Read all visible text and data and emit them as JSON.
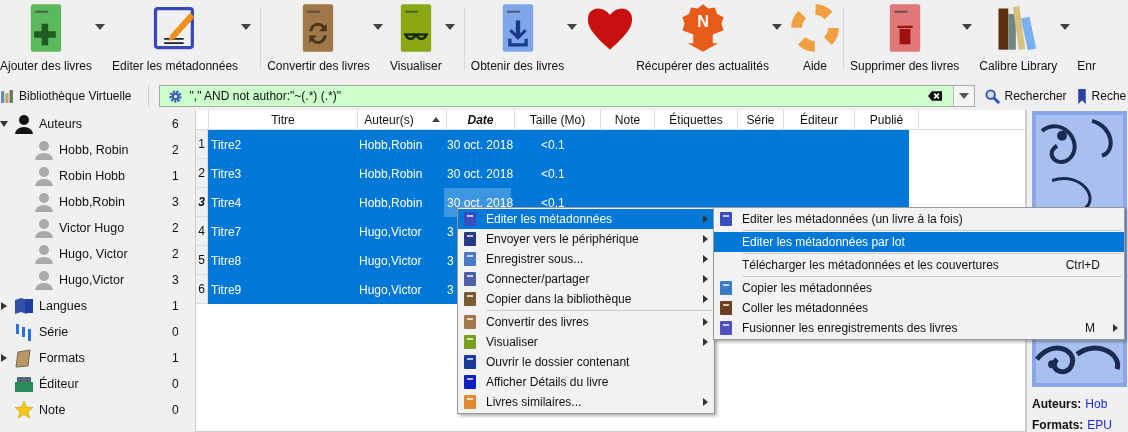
{
  "toolbar": {
    "groups": [
      [
        {
          "kind": "add",
          "label": "Ajouter des livres",
          "has_menu": true
        },
        {
          "kind": "edit",
          "label": "Editer les métadonnées",
          "has_menu": true
        }
      ],
      [
        {
          "kind": "convert",
          "label": "Convertir des livres",
          "has_menu": true
        },
        {
          "kind": "view",
          "label": "Visualiser",
          "has_menu": true
        }
      ],
      [
        {
          "kind": "get",
          "label": "Obtenir des livres",
          "has_menu": true
        },
        {
          "kind": "donate",
          "has_menu": false
        },
        {
          "kind": "news",
          "label": "Récupérer des actualités",
          "badge": "N",
          "has_menu": true
        },
        {
          "kind": "help",
          "label": "Aide",
          "has_menu": false
        }
      ],
      [
        {
          "kind": "remove",
          "label": "Supprimer des livres",
          "has_menu": true
        },
        {
          "kind": "library",
          "label": "Calibre Library",
          "has_menu": true
        },
        {
          "kind": "none",
          "label": "Enr",
          "has_menu": false
        }
      ]
    ]
  },
  "search_bar": {
    "virtual_library": "Bibliothèque Virtuelle",
    "query": "\",\" AND not author:\"~(.*) (.*)\"",
    "search_button": "Rechercher",
    "saved_search_button": "Reche"
  },
  "tag_browser": [
    {
      "kind": "authors",
      "label": "Auteurs",
      "count": "6",
      "expanded": true,
      "children": [
        {
          "kind": "author",
          "label": "Hobb, Robin",
          "count": "2"
        },
        {
          "kind": "author",
          "label": "Robin Hobb",
          "count": "1"
        },
        {
          "kind": "author",
          "label": "Hobb,Robin",
          "count": "3"
        },
        {
          "kind": "author",
          "label": "Victor Hugo",
          "count": "2"
        },
        {
          "kind": "author",
          "label": "Hugo, Victor",
          "count": "2"
        },
        {
          "kind": "author",
          "label": "Hugo,Victor",
          "count": "3"
        }
      ]
    },
    {
      "kind": "languages",
      "label": "Langues",
      "count": "1",
      "expanded": false
    },
    {
      "kind": "series",
      "label": "Série",
      "count": "0"
    },
    {
      "kind": "formats",
      "label": "Formats",
      "count": "1",
      "expanded": false
    },
    {
      "kind": "publisher",
      "label": "Éditeur",
      "count": "0"
    },
    {
      "kind": "rating",
      "label": "Note",
      "count": "0"
    }
  ],
  "table": {
    "columns": [
      {
        "label": "Titre",
        "sorted": false,
        "emphasized": false
      },
      {
        "label": "Auteur(s)",
        "sorted": true,
        "emphasized": false
      },
      {
        "label": "Date",
        "sorted": false,
        "emphasized": true
      },
      {
        "label": "Taille (Mo)",
        "sorted": false,
        "emphasized": false
      },
      {
        "label": "Note",
        "sorted": false,
        "emphasized": false
      },
      {
        "label": "Étiquettes",
        "sorted": false,
        "emphasized": false
      },
      {
        "label": "Série",
        "sorted": false,
        "emphasized": false
      },
      {
        "label": "Éditeur",
        "sorted": false,
        "emphasized": false
      },
      {
        "label": "Publié",
        "sorted": false,
        "emphasized": false
      }
    ],
    "rows": [
      {
        "number": "1",
        "selected": true,
        "current": false,
        "cells": [
          "Titre2",
          "Hobb,Robin",
          "30 oct. 2018",
          "<0.1"
        ]
      },
      {
        "number": "2",
        "selected": true,
        "current": false,
        "cells": [
          "Titre3",
          "Hobb,Robin",
          "30 oct. 2018",
          "<0.1"
        ]
      },
      {
        "number": "3",
        "selected": true,
        "current": true,
        "cells": [
          "Titre4",
          "Hobb,Robin",
          "30 oct. 2018",
          "<0.1"
        ]
      },
      {
        "number": "4",
        "selected": true,
        "current": false,
        "cells": [
          "Titre7",
          "Hugo,Victor",
          "3"
        ]
      },
      {
        "number": "5",
        "selected": true,
        "current": false,
        "cells": [
          "Titre8",
          "Hugo,Victor",
          "3"
        ]
      },
      {
        "number": "6",
        "selected": true,
        "current": false,
        "cells": [
          "Titre9",
          "Hugo,Victor",
          "3"
        ]
      }
    ]
  },
  "book_details": {
    "fields": [
      {
        "label": "Auteurs:",
        "value": "Hob"
      },
      {
        "label": "Formats:",
        "value": "EPU"
      }
    ]
  },
  "context_menu": [
    {
      "kind": "edit",
      "label": "Editer les métadonnées",
      "submenu": true,
      "selected": true
    },
    {
      "kind": "device",
      "label": "Envoyer vers le périphérique",
      "submenu": true,
      "selected": false
    },
    {
      "kind": "save",
      "label": "Enregistrer sous...",
      "submenu": true,
      "selected": false
    },
    {
      "kind": "share",
      "label": "Connecter/partager",
      "submenu": true,
      "selected": false
    },
    {
      "kind": "copy-lib",
      "label": "Copier dans la bibliothèque",
      "submenu": true,
      "selected": false
    },
    {
      "kind": "separator"
    },
    {
      "kind": "convert",
      "label": "Convertir des livres",
      "submenu": true,
      "selected": false
    },
    {
      "kind": "view",
      "label": "Visualiser",
      "submenu": true,
      "selected": false
    },
    {
      "kind": "folder",
      "label": "Ouvrir le dossier contenant",
      "submenu": false,
      "selected": false
    },
    {
      "kind": "info",
      "label": "Afficher Détails du livre",
      "submenu": false,
      "selected": false
    },
    {
      "kind": "similar",
      "label": "Livres similaires...",
      "submenu": true,
      "selected": false
    }
  ],
  "submenu": [
    {
      "kind": "edit",
      "label": "Editer les métadonnées (un livre à la fois)",
      "submenu": false,
      "selected": false
    },
    {
      "kind": "separator"
    },
    {
      "kind": "none",
      "label": "Editer les métadonnées par lot",
      "submenu": false,
      "selected": true
    },
    {
      "kind": "separator"
    },
    {
      "kind": "none",
      "label": "Télécharger les métadonnées et les couvertures",
      "shortcut": "Ctrl+D",
      "submenu": false,
      "selected": false
    },
    {
      "kind": "separator"
    },
    {
      "kind": "copy",
      "label": "Copier les métadonnées",
      "submenu": false,
      "selected": false
    },
    {
      "kind": "paste",
      "label": "Coller les métadonnées",
      "submenu": false,
      "selected": false
    },
    {
      "kind": "merge",
      "label": "Fusionner les enregistrements des livres",
      "shortcut": "M",
      "submenu": true,
      "selected": false
    }
  ]
}
